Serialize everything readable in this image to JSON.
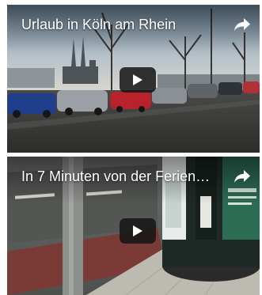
{
  "videos": [
    {
      "title": "Urlaub in Köln am Rhein",
      "play_icon": "play-icon",
      "share_icon": "share-icon"
    },
    {
      "title": "In 7 Minuten von der Ferien…",
      "play_icon": "play-icon",
      "share_icon": "share-icon"
    }
  ],
  "colors": {
    "overlay_text": "#ffffff",
    "play_button_bg": "#141414"
  }
}
